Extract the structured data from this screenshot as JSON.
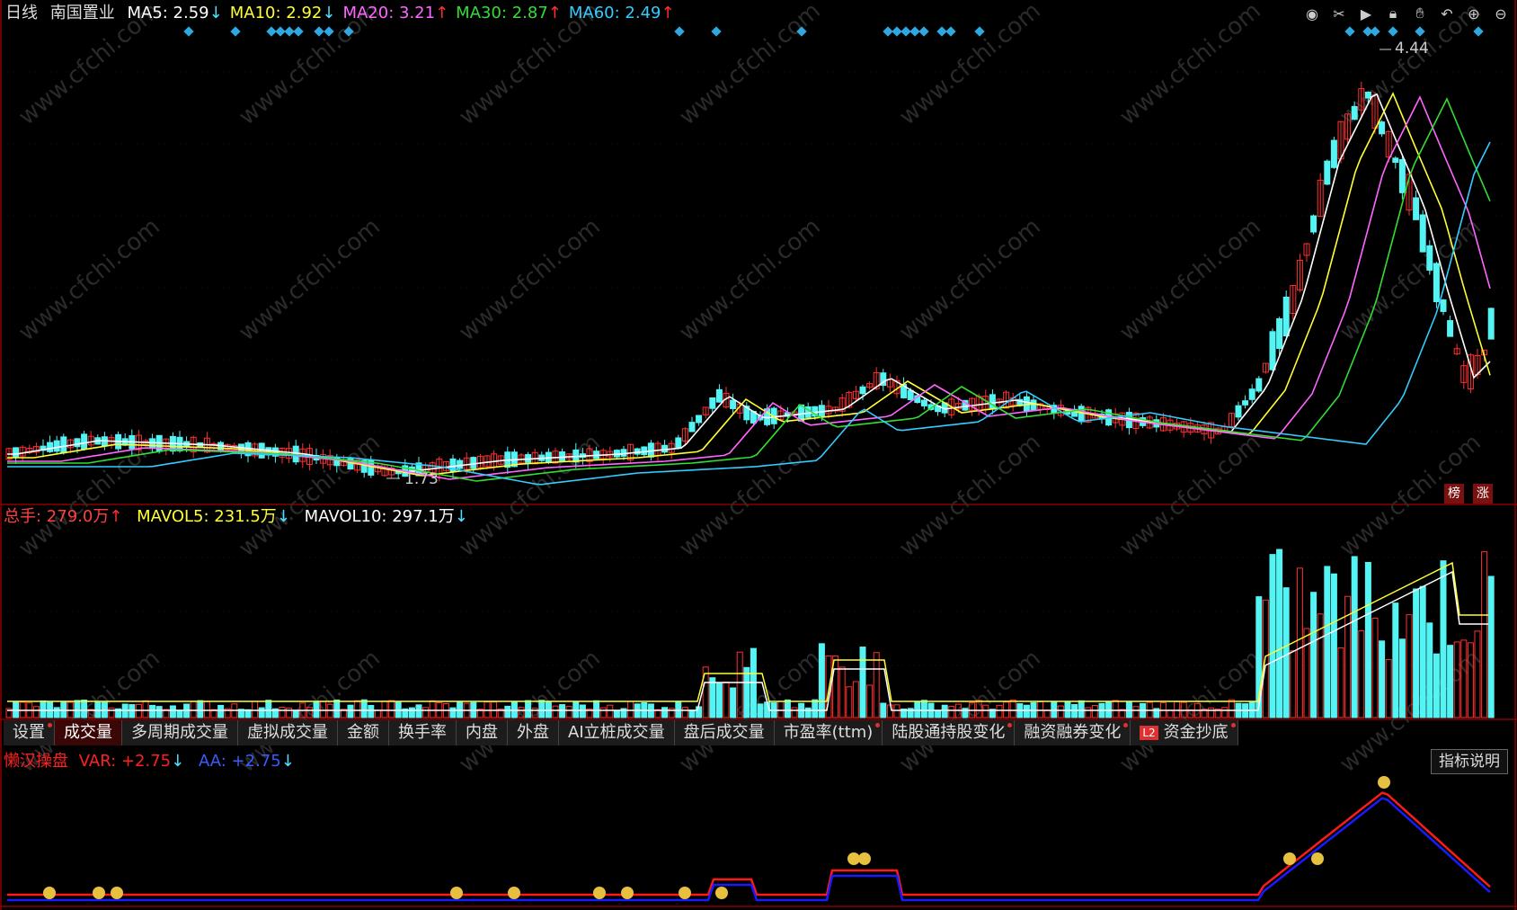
{
  "header": {
    "period": "日线",
    "stock_name": "南国置业",
    "ma": [
      {
        "label": "MA5: 2.59",
        "arrow": "↓",
        "color": "#ffffff",
        "arrow_color": "#4fe0ff"
      },
      {
        "label": "MA10: 2.92",
        "arrow": "↓",
        "color": "#ffff33",
        "arrow_color": "#4fe0ff"
      },
      {
        "label": "MA20: 3.21",
        "arrow": "↑",
        "color": "#ff66ff",
        "arrow_color": "#ff3030"
      },
      {
        "label": "MA30: 2.87",
        "arrow": "↑",
        "color": "#33dd33",
        "arrow_color": "#ff3030"
      },
      {
        "label": "MA60: 2.49",
        "arrow": "↑",
        "color": "#33ccff",
        "arrow_color": "#ff3030"
      }
    ]
  },
  "toolbar": [
    "eye-icon",
    "scissors-icon",
    "play-icon",
    "lock-icon",
    "hand-icon",
    "undo-icon",
    "zoom-in-icon",
    "zoom-out-icon"
  ],
  "price_chart": {
    "high_label": "4.44",
    "low_label": "1.73",
    "badges": [
      {
        "text": "榜",
        "color": "#8b1a1a"
      },
      {
        "text": "涨",
        "color": "#8b1a1a"
      }
    ]
  },
  "volume_header": {
    "total": "总手: 279.0万",
    "total_arrow": "↑",
    "mavol5": "MAVOL5: 231.5万",
    "mavol5_arrow": "↓",
    "mavol10": "MAVOL10: 297.1万",
    "mavol10_arrow": "↓"
  },
  "tabs": [
    {
      "label": "设置",
      "dot": true,
      "active": false
    },
    {
      "label": "成交量",
      "dot": false,
      "active": true
    },
    {
      "label": "多周期成交量",
      "dot": false,
      "active": false
    },
    {
      "label": "虚拟成交量",
      "dot": false,
      "active": false
    },
    {
      "label": "金额",
      "dot": false,
      "active": false
    },
    {
      "label": "换手率",
      "dot": false,
      "active": false
    },
    {
      "label": "内盘",
      "dot": false,
      "active": false
    },
    {
      "label": "外盘",
      "dot": false,
      "active": false
    },
    {
      "label": "AI立桩成交量",
      "dot": false,
      "active": false
    },
    {
      "label": "盘后成交量",
      "dot": false,
      "active": false
    },
    {
      "label": "市盈率(ttm)",
      "dot": true,
      "active": false
    },
    {
      "label": "陆股通持股变化",
      "dot": true,
      "active": false
    },
    {
      "label": "融资融券变化",
      "dot": true,
      "active": false
    },
    {
      "label": "资金抄底",
      "dot": true,
      "active": false,
      "l2": "L2"
    }
  ],
  "indicator_header": {
    "name": "懒汉操盘",
    "var_label": "VAR: +2.75",
    "var_arrow": "↓",
    "aa_label": "AA: +2.75",
    "aa_arrow": "↓"
  },
  "help_button": "指标说明",
  "watermark": "www.cfchi.com",
  "colors": {
    "up": "#ff3030",
    "down": "#54f4f4",
    "ma5": "#ffffff",
    "ma10": "#ffff33",
    "ma20": "#ff66ff",
    "ma30": "#33dd33",
    "ma60": "#33ccff",
    "var": "#ff1a1a",
    "aa": "#1a1aff",
    "axis": "#8b0000",
    "diamond": "#2fa7e0"
  }
}
